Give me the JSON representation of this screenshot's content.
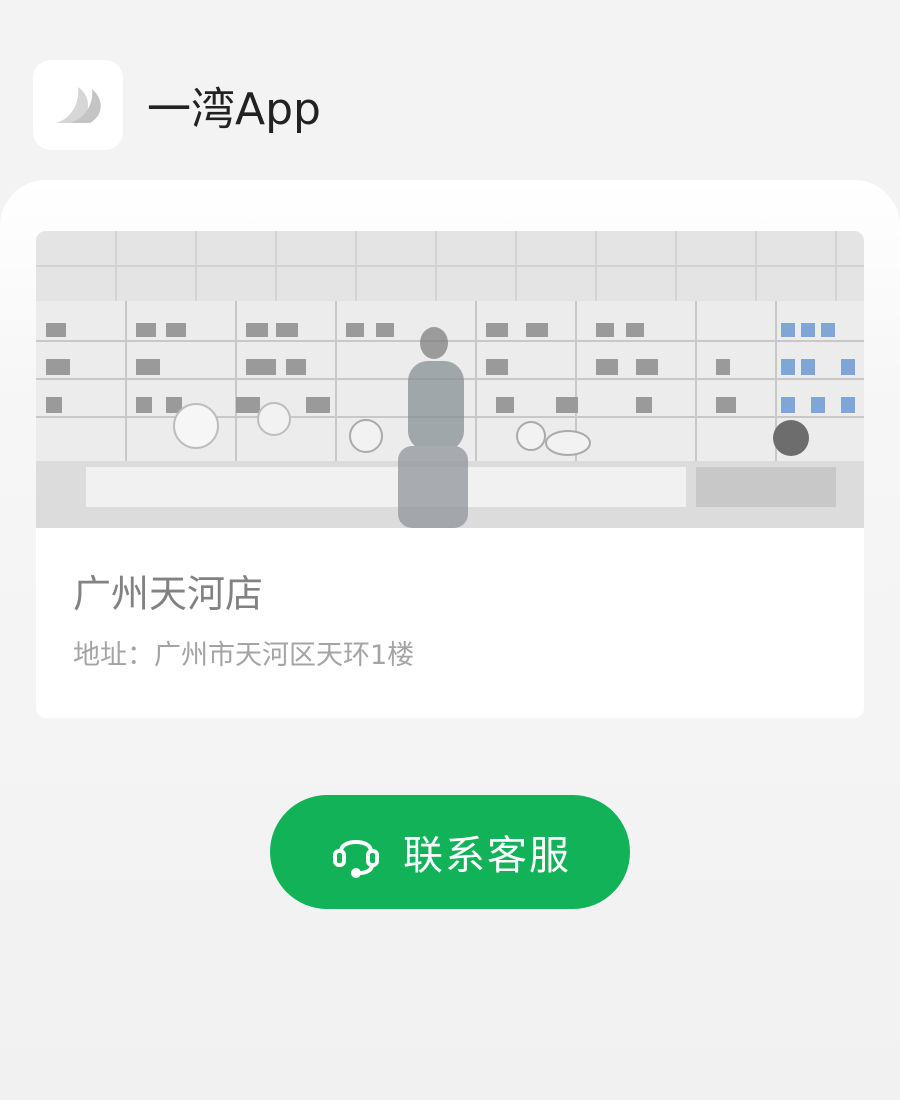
{
  "app": {
    "name": "一湾App",
    "logo_icon": "wave-logo-icon"
  },
  "store": {
    "name": "广州天河店",
    "address": "地址：广州市天河区天环1楼",
    "image": "store-interior-photo"
  },
  "contact_button": {
    "label": "联系客服",
    "icon": "headset-icon"
  },
  "colors": {
    "accent": "#12b259",
    "background": "#f3f3f3"
  }
}
